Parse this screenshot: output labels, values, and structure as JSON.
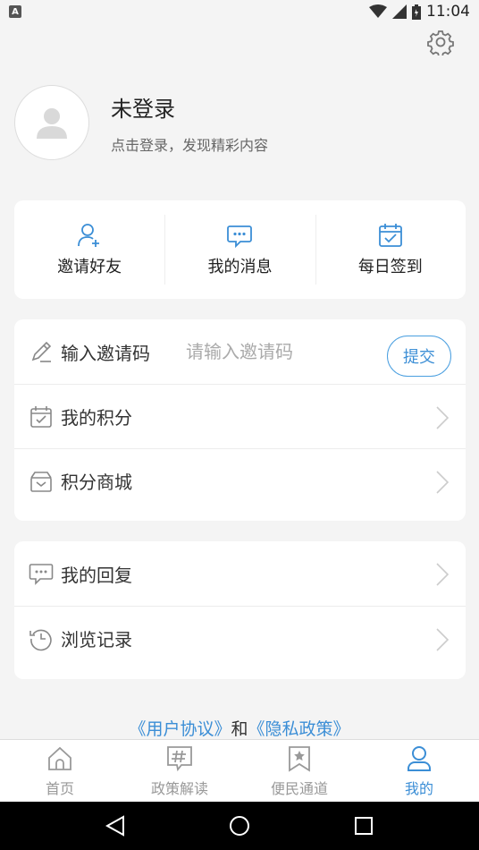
{
  "status_bar": {
    "time": "11:04",
    "notification_icon": "a-notification-icon"
  },
  "profile": {
    "name": "未登录",
    "subtitle": "点击登录，发现精彩内容"
  },
  "quick_actions": [
    {
      "label": "邀请好友",
      "icon": "add-user-icon"
    },
    {
      "label": "我的消息",
      "icon": "message-icon"
    },
    {
      "label": "每日签到",
      "icon": "calendar-check-icon"
    }
  ],
  "invite": {
    "label": "输入邀请码",
    "placeholder": "请输入邀请码",
    "value": "",
    "submit_label": "提交"
  },
  "menu1": [
    {
      "label": "我的积分",
      "icon": "calendar-points-icon"
    },
    {
      "label": "积分商城",
      "icon": "gift-icon"
    }
  ],
  "menu2": [
    {
      "label": "我的回复",
      "icon": "comment-icon"
    },
    {
      "label": "浏览记录",
      "icon": "history-icon"
    }
  ],
  "agreement": {
    "user_agreement": "《用户协议》",
    "and": "和",
    "privacy_policy": "《隐私政策》"
  },
  "bottom_nav": [
    {
      "label": "首页",
      "icon": "home-icon",
      "active": false
    },
    {
      "label": "政策解读",
      "icon": "hashtag-icon",
      "active": false
    },
    {
      "label": "便民通道",
      "icon": "bookmark-star-icon",
      "active": false
    },
    {
      "label": "我的",
      "icon": "user-icon",
      "active": true
    }
  ],
  "colors": {
    "accent": "#3b8ed6",
    "background": "#f4f4f4",
    "card": "#ffffff"
  }
}
